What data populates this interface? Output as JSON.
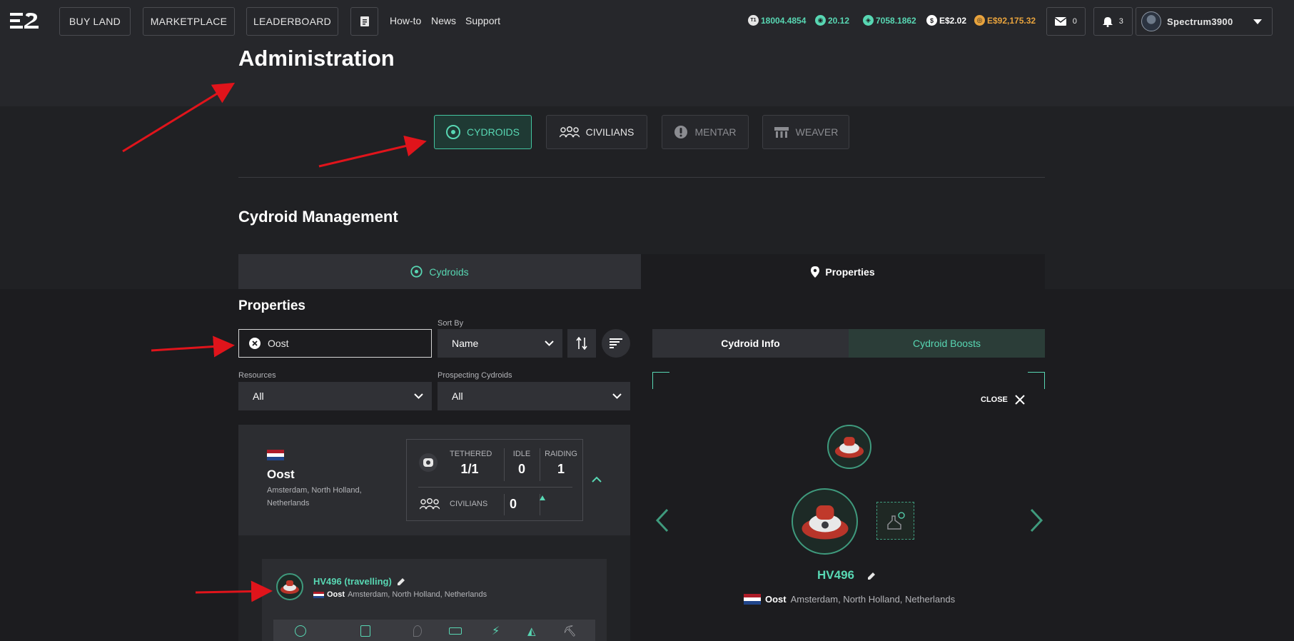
{
  "nav": {
    "buttons": [
      "BUY LAND",
      "MARKETPLACE",
      "LEADERBOARD"
    ],
    "links": [
      "How-to",
      "News",
      "Support"
    ]
  },
  "stats": [
    {
      "icon": "t1-token-icon",
      "glyph": "T1",
      "value": "18004.4854",
      "color": "#58d7b3"
    },
    {
      "icon": "energy-icon",
      "glyph": "◉",
      "value": "20.12",
      "color": "#58d7b3"
    },
    {
      "icon": "essence-icon",
      "glyph": "◈",
      "value": "7058.1862",
      "color": "#58d7b3"
    },
    {
      "icon": "dollar-icon",
      "glyph": "$",
      "value": "E$2.02",
      "color": "#ffffff"
    },
    {
      "icon": "coin-icon",
      "glyph": "◎",
      "value": "E$92,175.32",
      "color": "#e8a33d"
    }
  ],
  "mail_count": "0",
  "notif_count": "3",
  "username": "Spectrum3900",
  "page_title": "Administration",
  "categories": [
    "CYDROIDS",
    "CIVILIANS",
    "MENTAR",
    "WEAVER"
  ],
  "section_title": "Cydroid Management",
  "tabs": {
    "left": "Cydroids",
    "right": "Properties"
  },
  "properties": {
    "heading": "Properties",
    "search_value": "Oost",
    "sort_label": "Sort By",
    "sort_value": "Name",
    "resources_label": "Resources",
    "resources_value": "All",
    "prospecting_label": "Prospecting Cydroids",
    "prospecting_value": "All"
  },
  "property": {
    "name": "Oost",
    "location_line1": "Amsterdam, North Holland,",
    "location_line2": "Netherlands",
    "tethered_label": "TETHERED",
    "tethered_value": "1/1",
    "idle_label": "IDLE",
    "idle_value": "0",
    "raiding_label": "RAIDING",
    "raiding_value": "1",
    "civilians_label": "CIVILIANS",
    "civilians_value": "0"
  },
  "cydroid_row": {
    "name": "HV496 (travelling)",
    "place": "Oost",
    "location": "Amsterdam, North Holland, Netherlands"
  },
  "info_tabs": {
    "left": "Cydroid Info",
    "right": "Cydroid Boosts"
  },
  "close_label": "CLOSE",
  "detail": {
    "name": "HV496",
    "place": "Oost",
    "location": "Amsterdam, North Holland, Netherlands"
  },
  "colors": {
    "accent": "#58d7b3",
    "annotation": "#e0141b",
    "background": "#1c1c1f"
  }
}
